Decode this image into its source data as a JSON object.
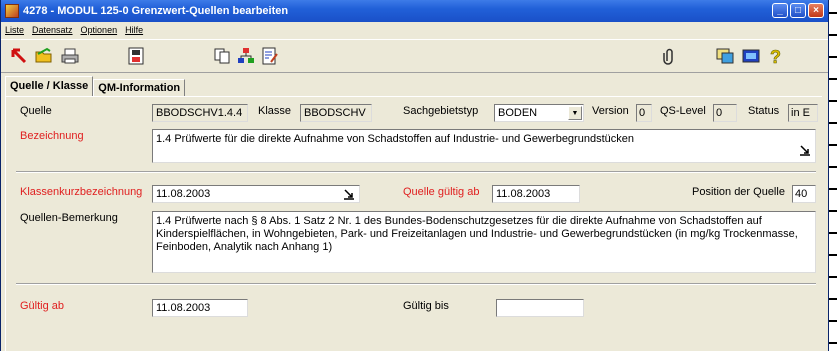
{
  "window": {
    "title": "4278 - MODUL 125-0 Grenzwert-Quellen bearbeiten"
  },
  "menu": {
    "items": [
      "Liste",
      "Datensatz",
      "Optionen",
      "Hilfe"
    ]
  },
  "tabs": [
    {
      "label": "Quelle / Klasse"
    },
    {
      "label": "QM-Information"
    }
  ],
  "form": {
    "quelle_label": "Quelle",
    "quelle_value": "BBODSCHV1.4.4",
    "klasse_label": "Klasse",
    "klasse_value": "BBODSCHV",
    "sachgebietstyp_label": "Sachgebietstyp",
    "sachgebietstyp_value": "BODEN",
    "version_label": "Version",
    "version_value": "0",
    "qs_level_label": "QS-Level",
    "qs_level_value": "0",
    "status_label": "Status",
    "status_value": "in E",
    "bezeichnung_label": "Bezeichnung",
    "bezeichnung_value": "1.4 Prüfwerte für die direkte Aufnahme von Schadstoffen auf Industrie- und Gewerbegrundstücken",
    "klassenkurz_label": "Klassenkurzbezeichnung",
    "klassenkurz_value": "11.08.2003",
    "quelle_gueltig_ab_label": "Quelle gültig ab",
    "quelle_gueltig_ab_value": "11.08.2003",
    "position_label": "Position der Quelle",
    "position_value": "40",
    "bemerkung_label": "Quellen-Bemerkung",
    "bemerkung_value": "1.4 Prüfwerte nach § 8 Abs. 1 Satz 2 Nr. 1 des Bundes-Bodenschutzgesetzes für die direkte Aufnahme von Schadstoffen auf Kinderspielflächen, in Wohngebieten, Park- und Freizeitanlagen und Industrie- und Gewerbegrundstücken (in mg/kg Trockenmasse, Feinboden, Analytik nach Anhang 1)",
    "gueltig_ab_label": "Gültig ab",
    "gueltig_ab_value": "11.08.2003",
    "gueltig_bis_label": "Gültig bis",
    "gueltig_bis_value": ""
  },
  "colors": {
    "title_bar": "#2160d8",
    "required_label": "#e02020",
    "window_bg": "#ece9d8"
  }
}
